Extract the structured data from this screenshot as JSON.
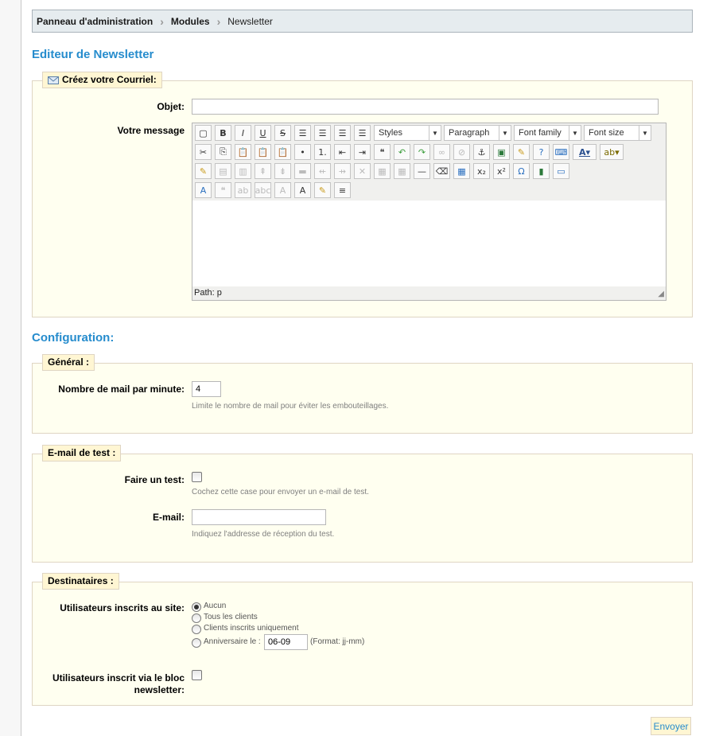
{
  "breadcrumb": {
    "items": [
      "Panneau d'administration",
      "Modules"
    ],
    "current": "Newsletter"
  },
  "editor_section": {
    "title": "Editeur de Newsletter",
    "legend": "Créez votre Courriel:",
    "subject_label": "Objet:",
    "subject_value": "",
    "message_label": "Votre message",
    "toolbar": {
      "styles": "Styles",
      "paragraph": "Paragraph",
      "font_family": "Font family",
      "font_size": "Font size"
    },
    "path_label": "Path: p"
  },
  "config": {
    "title": "Configuration:",
    "general": {
      "legend": "Général :",
      "rate_label": "Nombre de mail par minute:",
      "rate_value": "4",
      "rate_hint": "Limite le nombre de mail pour éviter les embouteillages."
    },
    "test": {
      "legend": "E-mail de test :",
      "do_test_label": "Faire un test:",
      "do_test_checked": false,
      "do_test_hint": "Cochez cette case pour envoyer un e-mail de test.",
      "email_label": "E-mail:",
      "email_value": "",
      "email_hint": "Indiquez l'addresse de réception du test."
    },
    "recipients": {
      "legend": "Destinataires :",
      "site_users_label": "Utilisateurs inscrits au site:",
      "options": [
        "Aucun",
        "Tous les clients",
        "Clients inscrits uniquement",
        "Anniversaire le :"
      ],
      "selected": "Aucun",
      "birthday_value": "06-09",
      "birthday_format": "(Format: jj-mm)",
      "block_users_label": "Utilisateurs inscrit via le bloc newsletter:",
      "block_users_checked": false
    }
  },
  "submit_label": "Envoyer",
  "colors": {
    "accent": "#268ccd",
    "fieldset_bg": "#fffff0",
    "legend_bg": "#fff6d3"
  }
}
